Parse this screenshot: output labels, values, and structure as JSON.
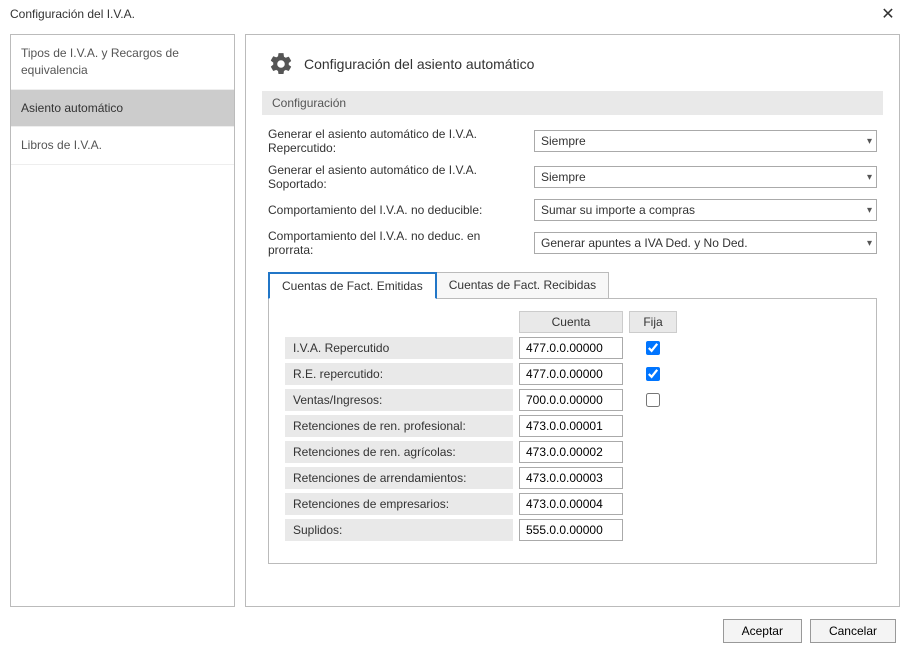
{
  "window": {
    "title": "Configuración del I.V.A.",
    "close_label": "✕"
  },
  "sidebar": {
    "items": [
      {
        "label": "Tipos de I.V.A. y Recargos de equivalencia",
        "selected": false
      },
      {
        "label": "Asiento automático",
        "selected": true
      },
      {
        "label": "Libros de I.V.A.",
        "selected": false
      }
    ]
  },
  "main": {
    "heading": "Configuración del asiento automático",
    "section_label": "Configuración",
    "fields": [
      {
        "label": "Generar el asiento automático de I.V.A. Repercutido:",
        "value": "Siempre"
      },
      {
        "label": "Generar el asiento automático de I.V.A. Soportado:",
        "value": "Siempre"
      },
      {
        "label": "Comportamiento del I.V.A. no deducible:",
        "value": "Sumar su importe a compras"
      },
      {
        "label": "Comportamiento del I.V.A. no deduc. en prorrata:",
        "value": "Generar apuntes a IVA Ded. y No Ded."
      }
    ],
    "tabs": [
      {
        "label": "Cuentas de Fact. Emitidas",
        "active": true
      },
      {
        "label": "Cuentas de Fact. Recibidas",
        "active": false
      }
    ],
    "accounts_table": {
      "headers": {
        "cuenta": "Cuenta",
        "fija": "Fija"
      },
      "rows": [
        {
          "label": "I.V.A. Repercutido",
          "cuenta": "477.0.0.00000",
          "fija": true,
          "show_fija": true
        },
        {
          "label": "R.E. repercutido:",
          "cuenta": "477.0.0.00000",
          "fija": true,
          "show_fija": true
        },
        {
          "label": "Ventas/Ingresos:",
          "cuenta": "700.0.0.00000",
          "fija": false,
          "show_fija": true
        },
        {
          "label": "Retenciones de ren. profesional:",
          "cuenta": "473.0.0.00001",
          "fija": false,
          "show_fija": false
        },
        {
          "label": "Retenciones de ren. agrícolas:",
          "cuenta": "473.0.0.00002",
          "fija": false,
          "show_fija": false
        },
        {
          "label": "Retenciones de arrendamientos:",
          "cuenta": "473.0.0.00003",
          "fija": false,
          "show_fija": false
        },
        {
          "label": "Retenciones de empresarios:",
          "cuenta": "473.0.0.00004",
          "fija": false,
          "show_fija": false
        },
        {
          "label": "Suplidos:",
          "cuenta": "555.0.0.00000",
          "fija": false,
          "show_fija": false
        }
      ]
    }
  },
  "footer": {
    "accept": "Aceptar",
    "cancel": "Cancelar"
  }
}
